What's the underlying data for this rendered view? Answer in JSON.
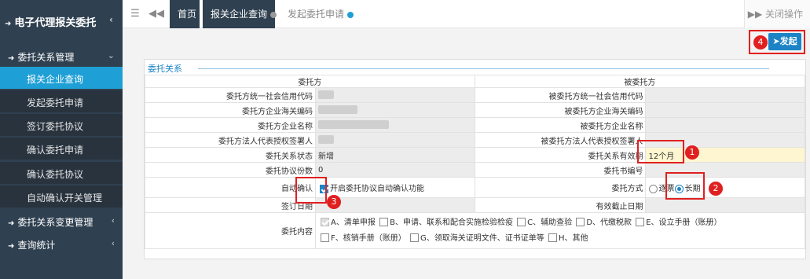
{
  "app": {
    "title": "电子代理报关委托"
  },
  "sidebar": {
    "groups": [
      {
        "label": "委托关系管理"
      },
      {
        "label": "委托关系变更管理"
      },
      {
        "label": "查询统计"
      }
    ],
    "items": [
      {
        "label": "报关企业查询"
      },
      {
        "label": "发起委托申请"
      },
      {
        "label": "签订委托协议"
      },
      {
        "label": "确认委托申请"
      },
      {
        "label": "确认委托协议"
      },
      {
        "label": "自动确认开关管理"
      }
    ]
  },
  "topbar": {
    "tabs": [
      {
        "label": "首页"
      },
      {
        "label": "报关企业查询"
      },
      {
        "label": "发起委托申请"
      }
    ],
    "close_ops": "关闭操作"
  },
  "actions": {
    "submit": "发起"
  },
  "annotations": {
    "n1": "1",
    "n2": "2",
    "n3": "3",
    "n4": "4"
  },
  "form": {
    "section_title": "委托关系",
    "headers": {
      "left": "委托方",
      "right": "被委托方"
    },
    "rows": {
      "credit_left": "委托方统一社会信用代码",
      "credit_right": "被委托方统一社会信用代码",
      "customs_left": "委托方企业海关编码",
      "customs_right": "被委托方企业海关编码",
      "name_left": "委托方企业名称",
      "name_right": "被委托方企业名称",
      "legal_left": "委托方法人代表授权签署人",
      "legal_right": "被委托方法人代表授权签署人",
      "status_label": "委托关系状态",
      "status_value": "新增",
      "validity_label": "委托关系有效期",
      "validity_value": "12个月",
      "count_label": "委托协议份数",
      "count_value": "0",
      "code_label": "委托书编号",
      "auto_label": "自动确认",
      "auto_option": "开启委托协议自动确认功能",
      "mode_label": "委托方式",
      "mode_single": "逐票",
      "mode_long": "长期",
      "sign_label": "签订日期",
      "expiry_label": "有效截止日期",
      "content_label": "委托内容",
      "content_options": [
        "A、清单申报",
        "B、申请、联系和配合实施检验检疫",
        "C、辅助查验",
        "D、代缴税款",
        "E、设立手册（账册）",
        "F、核销手册（账册）",
        "G、领取海关证明文件、证书证单等",
        "H、其他"
      ]
    }
  }
}
